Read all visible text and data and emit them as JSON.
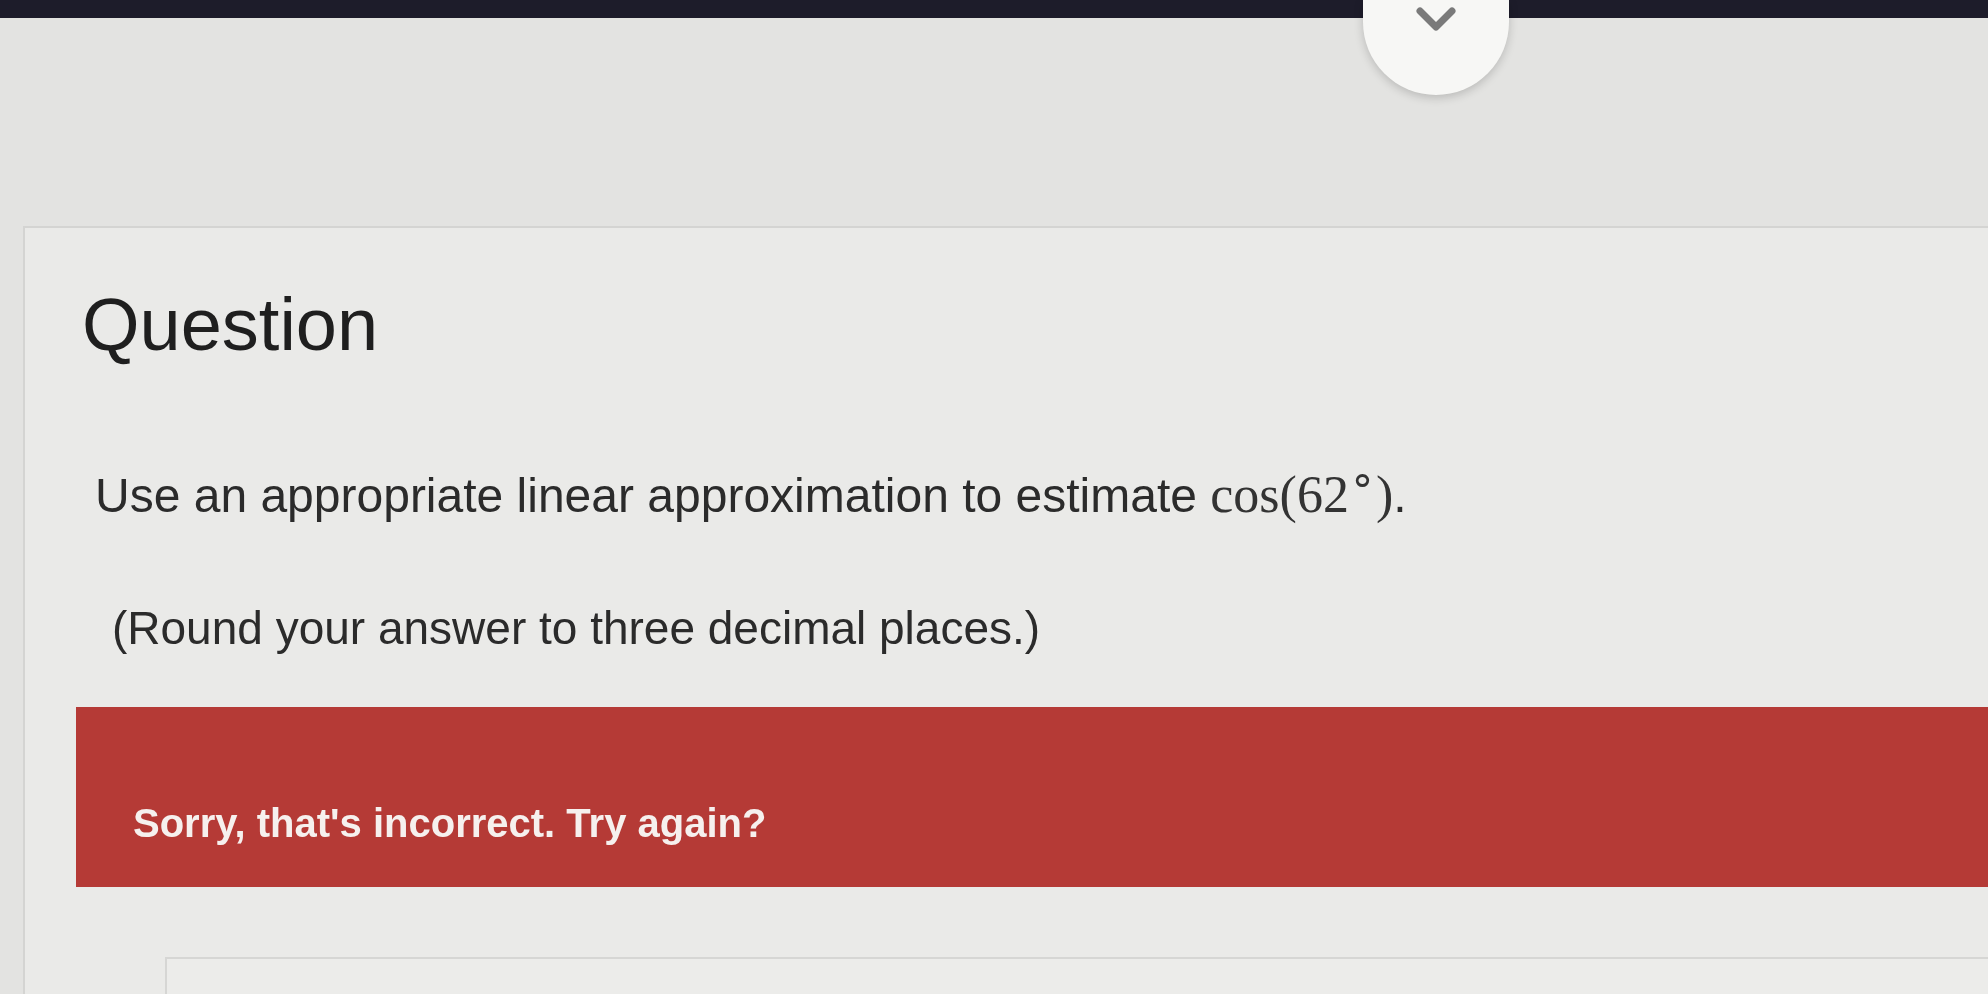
{
  "question": {
    "heading": "Question",
    "prompt": [
      {
        "kind": "text",
        "text": "Use an appropriate linear approximation to estimate "
      },
      {
        "kind": "math",
        "text": "cos(62$^{∘}$)"
      },
      {
        "kind": "text",
        "text": "."
      }
    ],
    "instruction": "(Round your answer to three decimal places.)"
  },
  "feedback": {
    "kind": "error",
    "message": "Sorry, that's incorrect. Try again?"
  }
}
